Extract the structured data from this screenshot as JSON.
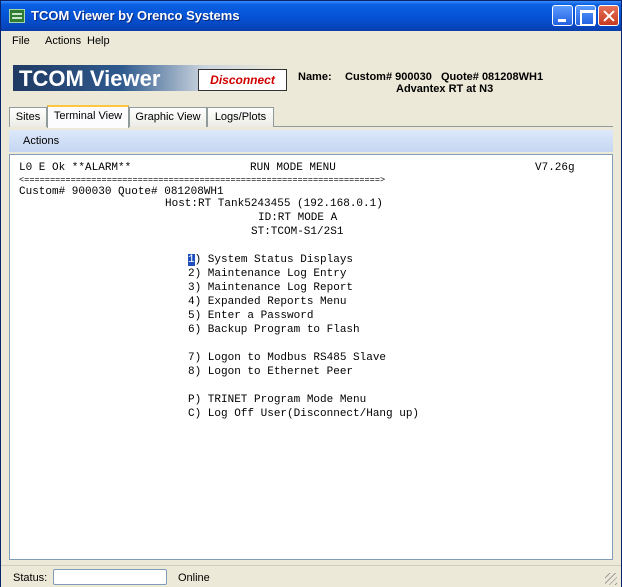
{
  "window": {
    "title": "TCOM Viewer by Orenco Systems"
  },
  "menu": [
    "File",
    "Actions",
    "Help"
  ],
  "header": {
    "logo_text": "TCOM Viewer",
    "disconnect_label": "Disconnect",
    "name_label": "Name:",
    "name_line1": "Custom# 900030   Quote# 081208WH1",
    "name_line2": "Advantex RT at N3"
  },
  "tabs": [
    "Sites",
    "Terminal View",
    "Graphic View",
    "Logs/Plots"
  ],
  "active_tab": "Terminal View",
  "actions_label": "Actions",
  "terminal": {
    "status_left": "L0 E Ok **ALARM**",
    "status_center": "RUN MODE MENU",
    "status_right": "V7.26g",
    "separator": "<=====================================================================>",
    "custom_line": "Custom# 900030 Quote# 081208WH1",
    "host_line": "Host:RT Tank5243455 (192.168.0.1)",
    "id_line": "ID:RT MODE A",
    "st_line": "ST:TCOM-S1/2S1",
    "cursor_char": "1",
    "menu_items": [
      ") System Status Displays",
      "2) Maintenance Log Entry",
      "3) Maintenance Log Report",
      "4) Expanded Reports Menu",
      "5) Enter a Password",
      "6) Backup Program to Flash",
      "7) Logon to Modbus RS485 Slave",
      "8) Logon to Ethernet Peer",
      "P) TRINET Program Mode Menu",
      "C) Log Off User(Disconnect/Hang up)"
    ]
  },
  "status": {
    "label": "Status:",
    "value": "Online"
  }
}
